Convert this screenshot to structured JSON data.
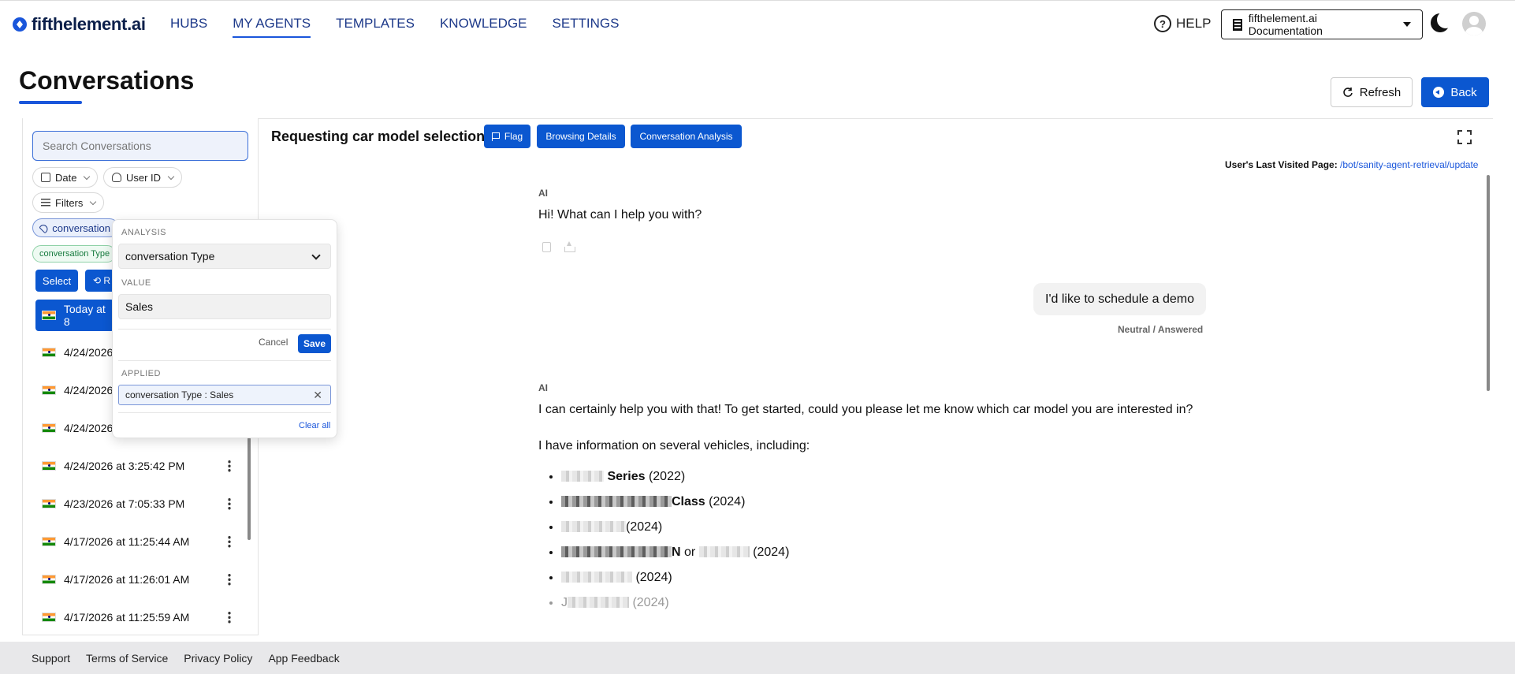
{
  "brand": {
    "name": "fifthelement.ai"
  },
  "nav": {
    "items": [
      "HUBS",
      "MY AGENTS",
      "TEMPLATES",
      "KNOWLEDGE",
      "SETTINGS"
    ],
    "active": "MY AGENTS"
  },
  "header": {
    "help_label": "HELP",
    "docs_label": "fifthelement.ai Documentation"
  },
  "page": {
    "title": "Conversations",
    "refresh_label": "Refresh",
    "back_label": "Back"
  },
  "sidebar": {
    "search_placeholder": "Search Conversations",
    "chips": {
      "date": "Date",
      "user_id": "User ID",
      "filters": "Filters",
      "tag": "conversation",
      "green_tag": "conversation Type : Sales"
    },
    "select_label": "Select",
    "r_label": "R",
    "conversations": [
      {
        "label": "Today at 8",
        "selected": true
      },
      {
        "label": "4/24/2026"
      },
      {
        "label": "4/24/2026"
      },
      {
        "label": "4/24/2026"
      },
      {
        "label": "4/24/2026 at 3:25:42 PM"
      },
      {
        "label": "4/23/2026 at 7:05:33 PM"
      },
      {
        "label": "4/17/2026 at 11:25:44 AM"
      },
      {
        "label": "4/17/2026 at 11:26:01 AM"
      },
      {
        "label": "4/17/2026 at 11:25:59 AM"
      }
    ]
  },
  "popover": {
    "analysis_label": "ANALYSIS",
    "analysis_value": "conversation Type",
    "value_label": "VALUE",
    "value_value": "Sales",
    "cancel_label": "Cancel",
    "save_label": "Save",
    "applied_label": "APPLIED",
    "applied_chip": "conversation Type : Sales",
    "clear_all_label": "Clear all"
  },
  "conversation": {
    "title": "Requesting car model selection.",
    "flag_label": "Flag",
    "browsing_label": "Browsing Details",
    "analysis_label": "Conversation Analysis",
    "last_visited_label": "User's Last Visited Page:",
    "last_visited_url": "/bot/sanity-agent-retrieval/update",
    "ai_label": "AI",
    "msg1": "Hi! What can I help you with?",
    "user_msg": "I'd like to schedule a demo",
    "sentiment": "Neutral / Answered",
    "msg2": "I can certainly help you with that! To get started, could you please let me know which car model you are interested in?",
    "msg3": "I have information on several vehicles, including:",
    "vehicles": [
      {
        "bold": "Series",
        "year": "(2022)"
      },
      {
        "bold": "Class",
        "year": "(2024)"
      },
      {
        "bold": "",
        "year": "(2024)"
      },
      {
        "bold": "N",
        "mid": "or",
        "year": "(2024)"
      },
      {
        "bold": "",
        "year": "(2024)"
      },
      {
        "bold": "J",
        "year": "(2024)"
      }
    ]
  },
  "footer": {
    "links": [
      "Support",
      "Terms of Service",
      "Privacy Policy",
      "App Feedback"
    ]
  }
}
